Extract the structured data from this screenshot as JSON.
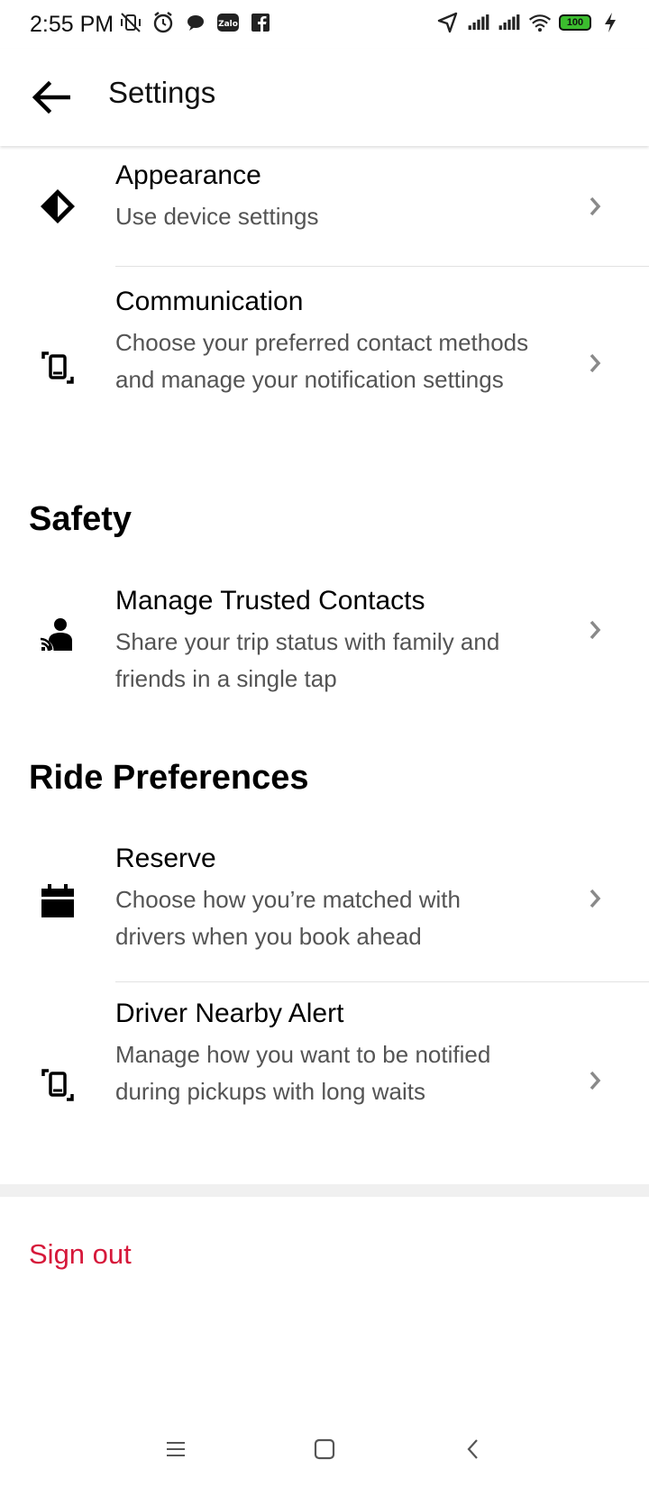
{
  "status_bar": {
    "time": "2:55 PM",
    "battery": "100",
    "left_icons": [
      "mute-vibrate-icon",
      "alarm-icon",
      "chat-bubble-icon",
      "zalo-icon",
      "facebook-icon"
    ],
    "right_icons": [
      "location-arrow-icon",
      "signal-icon",
      "signal-icon",
      "wifi-icon",
      "battery-icon",
      "charging-icon"
    ]
  },
  "header": {
    "title": "Settings"
  },
  "settings": {
    "appearance": {
      "title": "Appearance",
      "subtitle": "Use device settings"
    },
    "communication": {
      "title": "Communication",
      "subtitle": "Choose your preferred contact methods and manage your notification settings"
    }
  },
  "safety": {
    "heading": "Safety",
    "trusted_contacts": {
      "title": "Manage Trusted Contacts",
      "subtitle": "Share your trip status with family and friends in a single tap"
    }
  },
  "ride_preferences": {
    "heading": "Ride Preferences",
    "reserve": {
      "title": "Reserve",
      "subtitle": "Choose how you’re matched with drivers when you book ahead"
    },
    "driver_nearby": {
      "title": "Driver Nearby Alert",
      "subtitle": "Manage how you want to be notified during pickups with long waits"
    }
  },
  "sign_out": "Sign out",
  "colors": {
    "accent_red": "#d6183a",
    "subtitle_gray": "#545454",
    "chevron_gray": "#8a8a8a"
  }
}
